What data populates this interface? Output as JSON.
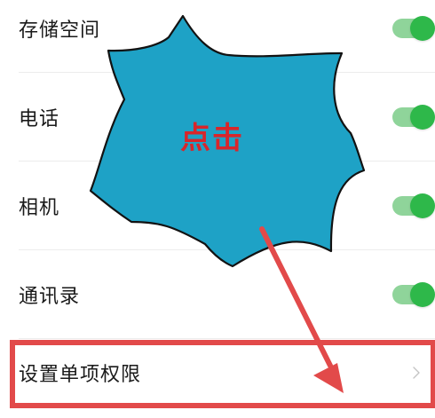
{
  "settings": {
    "rows": [
      {
        "label": "存储空间",
        "toggle_on": true
      },
      {
        "label": "电话",
        "toggle_on": true
      },
      {
        "label": "相机",
        "toggle_on": true
      },
      {
        "label": "通讯录",
        "toggle_on": true
      }
    ],
    "single_permission": {
      "label": "设置单项权限"
    }
  },
  "annotation": {
    "callout_text": "点击",
    "callout_color": "#1ea2c6",
    "text_color": "#d9252a",
    "arrow_color": "#e24a4a",
    "highlight_box_color": "#e24a4a"
  },
  "colors": {
    "toggle_track": "#8fd49a",
    "toggle_knob": "#2eb84a"
  },
  "icons": {
    "chevron": "chevron-right-icon"
  }
}
